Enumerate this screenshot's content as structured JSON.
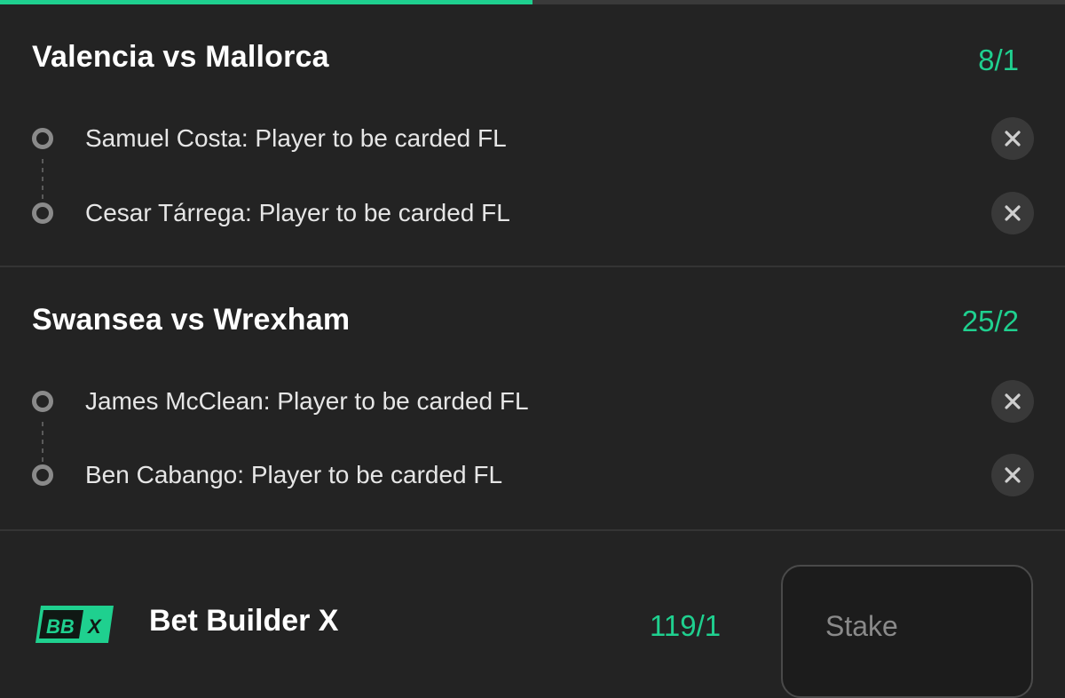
{
  "progress": {
    "fraction": 0.5,
    "color": "#1fd08f"
  },
  "matches": [
    {
      "title": "Valencia vs Mallorca",
      "odds": "8/1",
      "legs": [
        {
          "label": "Samuel Costa: Player to be carded FL",
          "remove_icon": "close-icon"
        },
        {
          "label": "Cesar Tárrega: Player to be carded FL",
          "remove_icon": "close-icon"
        }
      ]
    },
    {
      "title": "Swansea vs Wrexham",
      "odds": "25/2",
      "legs": [
        {
          "label": "James McClean: Player to be carded FL",
          "remove_icon": "close-icon"
        },
        {
          "label": "Ben Cabango: Player to be carded FL",
          "remove_icon": "close-icon"
        }
      ]
    }
  ],
  "footer": {
    "logo": {
      "left": "BB",
      "right": "X",
      "icon": "bet-builder-x-logo"
    },
    "title": "Bet Builder X",
    "odds": "119/1",
    "stake_placeholder": "Stake"
  },
  "colors": {
    "accent": "#1fd08f",
    "background": "#232323",
    "text": "#ffffff"
  }
}
